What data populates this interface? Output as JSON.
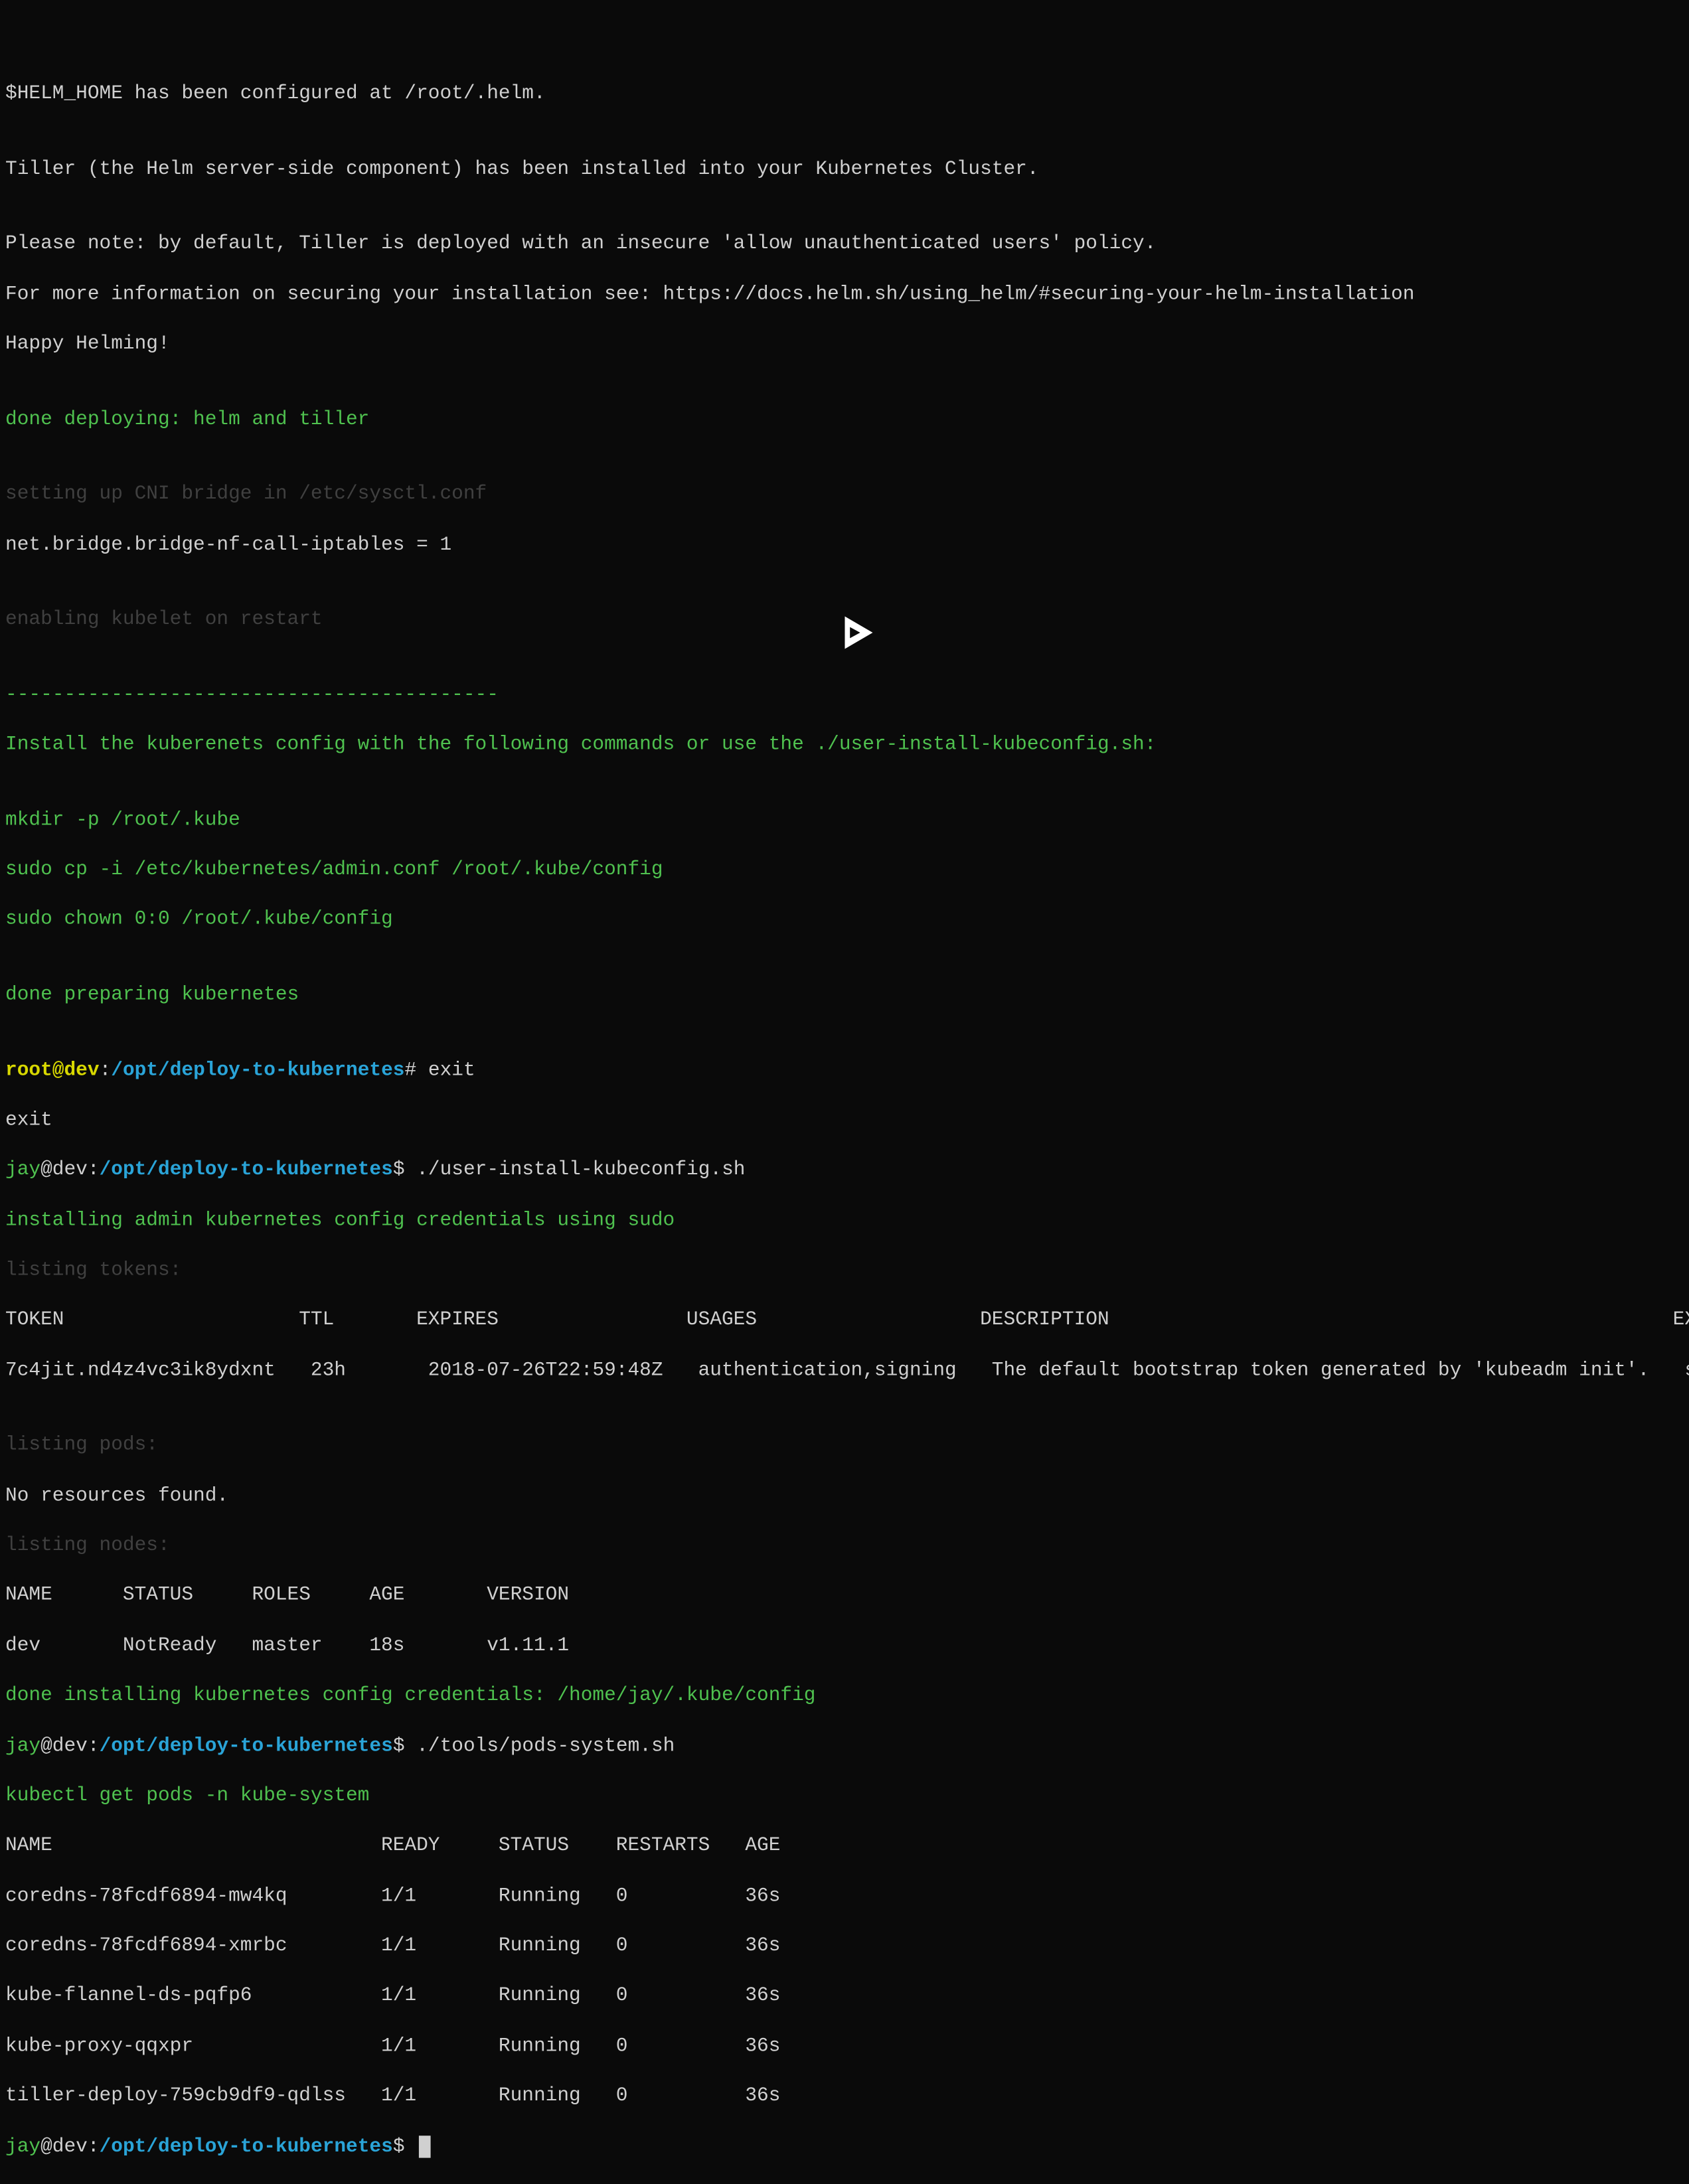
{
  "lines": {
    "l01": "$HELM_HOME has been configured at /root/.helm.",
    "l02": "",
    "l03": "Tiller (the Helm server-side component) has been installed into your Kubernetes Cluster.",
    "l04": "",
    "l05": "Please note: by default, Tiller is deployed with an insecure 'allow unauthenticated users' policy.",
    "l06": "For more information on securing your installation see: https://docs.helm.sh/using_helm/#securing-your-helm-installation",
    "l07": "Happy Helming!",
    "l08": "",
    "l09": "done deploying: helm and tiller",
    "l10": "",
    "l11": "setting up CNI bridge in /etc/sysctl.conf",
    "l12": "net.bridge.bridge-nf-call-iptables = 1",
    "l13": "",
    "l14": "enabling kubelet on restart",
    "l15": "",
    "l16": "------------------------------------------",
    "l17": "Install the kuberenets config with the following commands or use the ./user-install-kubeconfig.sh:",
    "l18": "",
    "l19": "mkdir -p /root/.kube",
    "l20": "sudo cp -i /etc/kubernetes/admin.conf /root/.kube/config",
    "l21": "sudo chown 0:0 /root/.kube/config",
    "l22": "",
    "l23": "done preparing kubernetes",
    "l24": "",
    "prompt1_user": "root",
    "prompt1_at": "@",
    "prompt1_host": "dev",
    "prompt1_colon": ":",
    "prompt1_path": "/opt/deploy-to-kubernetes",
    "prompt1_hash": "#",
    "prompt1_cmd": " exit",
    "l26": "exit",
    "prompt2_user": "jay",
    "prompt2_at": "@",
    "prompt2_host": "dev",
    "prompt2_colon": ":",
    "prompt2_path": "/opt/deploy-to-kubernetes",
    "prompt2_dollar": "$",
    "prompt2_cmd": " ./user-install-kubeconfig.sh",
    "l28": "installing admin kubernetes config credentials using sudo",
    "l29": "listing tokens:",
    "l30": "TOKEN                    TTL       EXPIRES                USAGES                   DESCRIPTION                                                EXTRA GROUPS",
    "l31": "7c4jit.nd4z4vc3ik8ydxnt   23h       2018-07-26T22:59:48Z   authentication,signing   The default bootstrap token generated by 'kubeadm init'.   system:bootstrappers:kubeadm:default-node-token",
    "l32": "",
    "l33": "listing pods:",
    "l34": "No resources found.",
    "l35": "listing nodes:",
    "l36": "NAME      STATUS     ROLES     AGE       VERSION",
    "l37": "dev       NotReady   master    18s       v1.11.1",
    "l38": "done installing kubernetes config credentials: /home/jay/.kube/config",
    "prompt3_user": "jay",
    "prompt3_at": "@",
    "prompt3_host": "dev",
    "prompt3_colon": ":",
    "prompt3_path": "/opt/deploy-to-kubernetes",
    "prompt3_dollar": "$",
    "prompt3_cmd": " ./tools/pods-system.sh",
    "l40": "kubectl get pods -n kube-system",
    "l41": "NAME                            READY     STATUS    RESTARTS   AGE",
    "l42": "coredns-78fcdf6894-mw4kq        1/1       Running   0          36s",
    "l43": "coredns-78fcdf6894-xmrbc        1/1       Running   0          36s",
    "l44": "kube-flannel-ds-pqfp6           1/1       Running   0          36s",
    "l45": "kube-proxy-qqxpr                1/1       Running   0          36s",
    "l46": "tiller-deploy-759cb9df9-qdlss   1/1       Running   0          36s",
    "prompt4_user": "jay",
    "prompt4_at": "@",
    "prompt4_host": "dev",
    "prompt4_colon": ":",
    "prompt4_path": "/opt/deploy-to-kubernetes",
    "prompt4_dollar": "$",
    "prompt4_cmd": " "
  }
}
